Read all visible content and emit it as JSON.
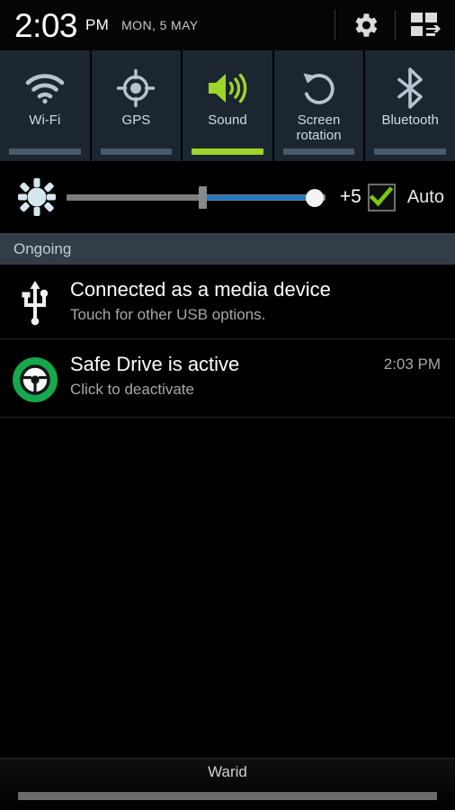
{
  "statusbar": {
    "time": "2:03",
    "ampm": "PM",
    "date": "MON, 5 MAY",
    "settings_icon": "gear-icon",
    "grid_icon": "quick-settings-grid-icon"
  },
  "toggles": [
    {
      "label": "Wi-Fi",
      "icon": "wifi-icon",
      "active": false
    },
    {
      "label": "GPS",
      "icon": "gps-crosshair-icon",
      "active": false
    },
    {
      "label": "Sound",
      "icon": "speaker-sound-icon",
      "active": true
    },
    {
      "label": "Screen\nrotation",
      "icon": "rotate-icon",
      "active": false
    },
    {
      "label": "Bluetooth",
      "icon": "bluetooth-icon",
      "active": false
    }
  ],
  "toggle_labels": {
    "wifi": "Wi-Fi",
    "gps": "GPS",
    "sound": "Sound",
    "screen_rotation_line1": "Screen",
    "screen_rotation_line2": "rotation",
    "bluetooth": "Bluetooth"
  },
  "brightness": {
    "icon": "brightness-sun-icon",
    "value_label": "+5",
    "auto_label": "Auto",
    "auto_checked": true,
    "slider_percent": 96,
    "tick_percent": 51
  },
  "sections": {
    "ongoing": "Ongoing"
  },
  "notifications": [
    {
      "icon": "usb-icon",
      "title": "Connected as a media device",
      "subtitle": "Touch for other USB options.",
      "time": ""
    },
    {
      "icon": "safe-drive-steering-wheel-icon",
      "title": "Safe Drive is active",
      "subtitle": "Click to deactivate",
      "time": "2:03 PM"
    }
  ],
  "footer": {
    "carrier": "Warid",
    "handle": "drag-handle"
  },
  "colors": {
    "toggle_panel": "#1b2630",
    "active_green": "#9fd428",
    "slider_blue": "#1d7cc4",
    "section_header": "#333d47",
    "safe_drive_green": "#16a84b"
  }
}
